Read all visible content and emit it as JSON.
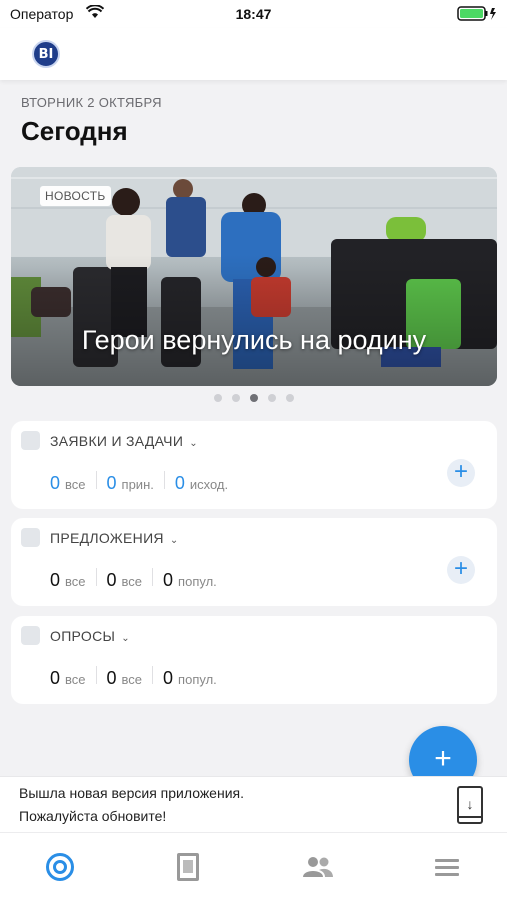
{
  "status_bar": {
    "carrier": "Оператор",
    "time": "18:47"
  },
  "header": {
    "logo_text": "BI"
  },
  "date_label": "ВТОРНИК 2 ОКТЯБРЯ",
  "page_title": "Сегодня",
  "news": {
    "badge": "НОВОСТЬ",
    "title": "Герои вернулись на родину",
    "dots_count": 5,
    "active_dot": 2
  },
  "widgets": [
    {
      "title": "ЗАЯВКИ И ЗАДАЧИ",
      "stats": [
        {
          "value": "0",
          "label": "все",
          "color": "#2a8ee6"
        },
        {
          "value": "0",
          "label": "прин.",
          "color": "#2a8ee6"
        },
        {
          "value": "0",
          "label": "исход.",
          "color": "#2a8ee6"
        }
      ],
      "has_add": true
    },
    {
      "title": "ПРЕДЛОЖЕНИЯ",
      "stats": [
        {
          "value": "0",
          "label": "все"
        },
        {
          "value": "0",
          "label": "все"
        },
        {
          "value": "0",
          "label": "попул."
        }
      ],
      "has_add": true
    },
    {
      "title": "ОПРОСЫ",
      "stats": [
        {
          "value": "0",
          "label": "все"
        },
        {
          "value": "0",
          "label": "все"
        },
        {
          "value": "0",
          "label": "попул."
        }
      ],
      "has_add": false
    }
  ],
  "fab_label": "+",
  "update_banner": {
    "line1": "Вышла новая версия приложения.",
    "line2": "Пожалуйста обновите!"
  },
  "tabs": [
    {
      "name": "home",
      "icon": "target-icon",
      "active": true
    },
    {
      "name": "documents",
      "icon": "document-icon",
      "active": false
    },
    {
      "name": "people",
      "icon": "people-icon",
      "active": false
    },
    {
      "name": "menu",
      "icon": "menu-icon",
      "active": false
    }
  ],
  "colors": {
    "accent": "#2a8ee6",
    "background": "#f2f2f4"
  }
}
